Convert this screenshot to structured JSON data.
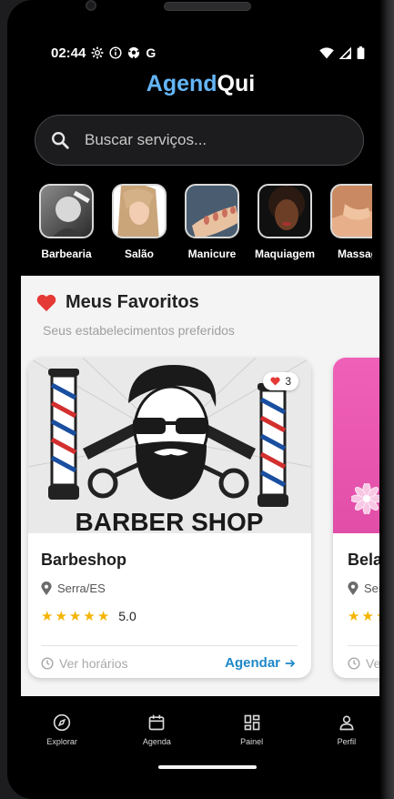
{
  "status_bar": {
    "time": "02:44",
    "g_label": "G"
  },
  "app": {
    "title_part1": "Agend",
    "title_part2": "Qui"
  },
  "search": {
    "placeholder": "Buscar serviços..."
  },
  "categories": [
    {
      "label": "Barbearia"
    },
    {
      "label": "Salão"
    },
    {
      "label": "Manicure"
    },
    {
      "label": "Maquiagem"
    },
    {
      "label": "Massag"
    }
  ],
  "favorites": {
    "title": "Meus Favoritos",
    "subtitle": "Seus estabelecimentos preferidos",
    "cards": [
      {
        "banner_text": "BARBER SHOP",
        "likes": "3",
        "name": "Barbeshop",
        "location": "Serra/ES",
        "rating": "5.0",
        "stars": 5,
        "hours_label": "Ver horários",
        "book_label": "Agendar"
      },
      {
        "name": "Bela",
        "location": "Serr",
        "hours_label": "Ver"
      }
    ]
  },
  "nav": [
    {
      "label": "Explorar",
      "icon": "compass-icon"
    },
    {
      "label": "Agenda",
      "icon": "calendar-icon"
    },
    {
      "label": "Painel",
      "icon": "dashboard-icon"
    },
    {
      "label": "Perfil",
      "icon": "person-icon"
    }
  ],
  "colors": {
    "accent": "#1e88c8",
    "logo_blue": "#64b5f6",
    "heart": "#e53935",
    "star": "#f4b400"
  }
}
